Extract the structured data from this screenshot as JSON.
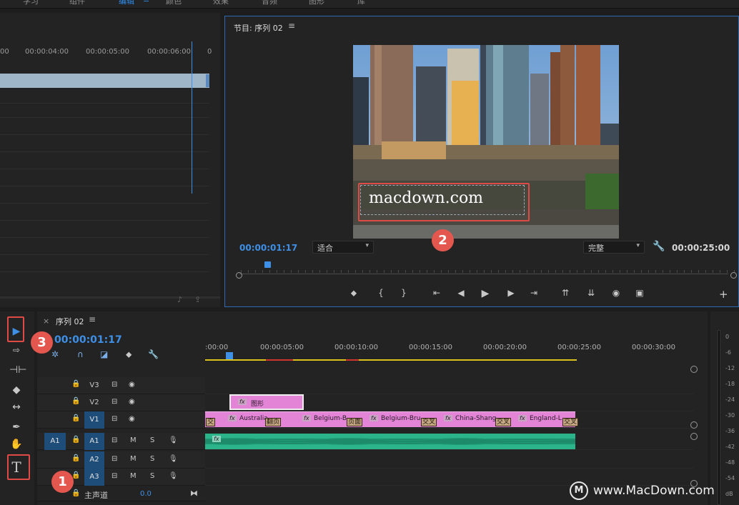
{
  "workspace_tabs": [
    "学习",
    "组件",
    "编辑",
    "颜色",
    "效果",
    "音频",
    "图形",
    "库"
  ],
  "workspace_active": "编辑",
  "source": {
    "ruler": [
      "00",
      "00:00:04:00",
      "00:00:05:00",
      "00:00:06:00",
      "0"
    ]
  },
  "program": {
    "title": "节目: 序列 02",
    "menu_icon": "≡",
    "timecode_current": "00:00:01:17",
    "timecode_duration": "00:00:25:00",
    "fit_label": "适合",
    "quality_label": "完整",
    "title_text": "macdown.com"
  },
  "timeline": {
    "close": "×",
    "title": "序列 02",
    "menu_icon": "≡",
    "timecode": "00:00:01:17",
    "ruler": [
      ":00:00",
      "00:00:05:00",
      "00:00:10:00",
      "00:00:15:00",
      "00:00:20:00",
      "00:00:25:00",
      "00:00:30:00"
    ],
    "tracks": {
      "v3": "V3",
      "v2": "V2",
      "v1": "V1",
      "a1_src": "A1",
      "a1": "A1",
      "a2": "A2",
      "a3": "A3",
      "m": "M",
      "s": "S"
    },
    "master_label": "主声道",
    "master_value": "0.0",
    "clips": {
      "graphic": "图形",
      "fx": "fx",
      "v1": [
        "Australia",
        "Belgium-B",
        "Belgium-Bru",
        "China-Shang",
        "England-L"
      ],
      "transitions": [
        "交",
        "翻页",
        "页面",
        "交叉",
        "交叉",
        "交叉"
      ]
    }
  },
  "meter_labels": [
    "0",
    "-6",
    "-12",
    "-18",
    "-24",
    "-30",
    "-36",
    "-42",
    "-48",
    "-54",
    "dB"
  ],
  "badges": [
    "1",
    "2",
    "3"
  ],
  "watermark": {
    "logo": "M",
    "text": "www.MacDown.com"
  },
  "colors": {
    "accent_blue": "#3e8fe6",
    "clip_pink": "#e384d6",
    "audio_green": "#2bb38a",
    "highlight_red": "#e04a46"
  }
}
